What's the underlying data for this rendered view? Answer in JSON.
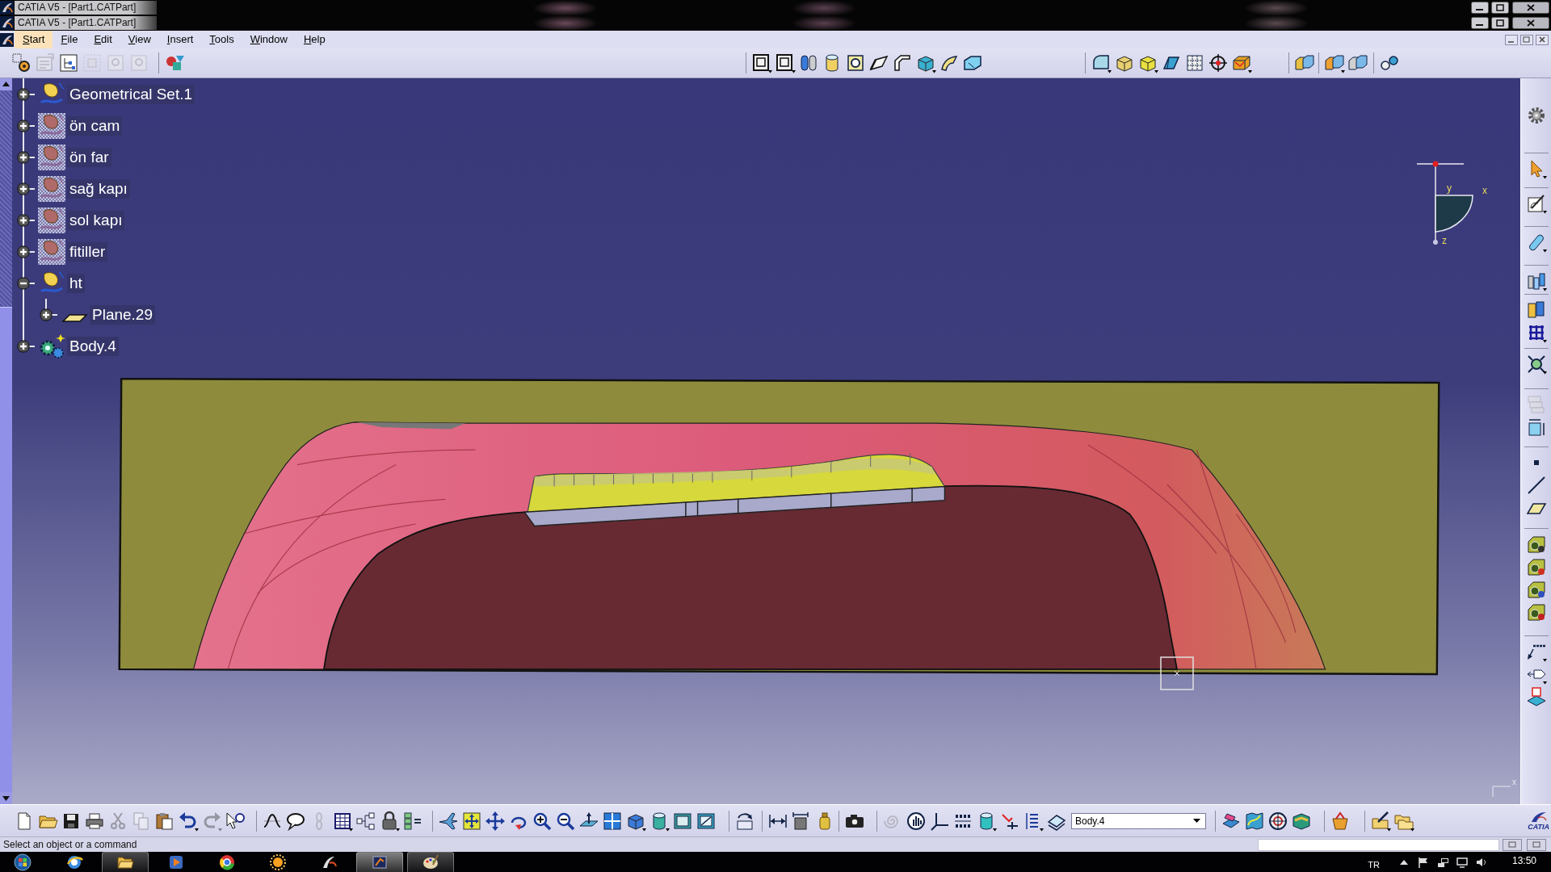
{
  "title_bars": [
    {
      "title": "CATIA V5 - [Part1.CATPart]"
    },
    {
      "title": "CATIA V5 - [Part1.CATPart]"
    }
  ],
  "menu": [
    {
      "label": "Start",
      "selected": true
    },
    {
      "label": "File",
      "selected": false
    },
    {
      "label": "Edit",
      "selected": false
    },
    {
      "label": "View",
      "selected": false
    },
    {
      "label": "Insert",
      "selected": false
    },
    {
      "label": "Tools",
      "selected": false
    },
    {
      "label": "Window",
      "selected": false
    },
    {
      "label": "Help",
      "selected": false
    }
  ],
  "toolbars": {
    "top": [
      {
        "disabled": false
      },
      {
        "disabled": true
      },
      {
        "disabled": false
      },
      {
        "disabled": true
      },
      {
        "disabled": true
      },
      {
        "disabled": true
      },
      {
        "disabled": false
      },
      {
        "disabled": false
      },
      {
        "disabled": false
      },
      {
        "disabled": false
      },
      {
        "disabled": false
      },
      {
        "disabled": false
      },
      {
        "disabled": false
      },
      {
        "disabled": false
      },
      {
        "disabled": false
      },
      {
        "disabled": false
      },
      {
        "disabled": false
      },
      {
        "disabled": false
      },
      {
        "disabled": false
      },
      {
        "disabled": false
      },
      {
        "disabled": false
      },
      {
        "disabled": false
      },
      {
        "disabled": false
      },
      {
        "disabled": false
      },
      {
        "disabled": false
      },
      {
        "disabled": false
      },
      {
        "disabled": false
      },
      {
        "disabled": false
      }
    ],
    "right": [
      {
        "disabled": false
      },
      {
        "disabled": false
      },
      {
        "disabled": false
      },
      {
        "disabled": false
      },
      {
        "disabled": false
      },
      {
        "disabled": false
      },
      {
        "disabled": false
      },
      {
        "disabled": false
      },
      {
        "disabled": true
      },
      {
        "disabled": false
      },
      {
        "disabled": false
      },
      {
        "disabled": false
      },
      {
        "disabled": false
      },
      {
        "disabled": false
      },
      {
        "disabled": false
      },
      {
        "disabled": false
      },
      {
        "disabled": false
      },
      {
        "disabled": false
      },
      {
        "disabled": false
      },
      {
        "disabled": false
      }
    ],
    "bottom_left": [
      {
        "disabled": false
      },
      {
        "disabled": false
      },
      {
        "disabled": false
      },
      {
        "disabled": false
      },
      {
        "disabled": true
      },
      {
        "disabled": true
      },
      {
        "disabled": false
      },
      {
        "disabled": false
      },
      {
        "disabled": true
      },
      {
        "disabled": false
      },
      {
        "disabled": false
      },
      {
        "disabled": false
      },
      {
        "disabled": true
      },
      {
        "disabled": false
      },
      {
        "disabled": false
      },
      {
        "disabled": false
      },
      {
        "disabled": false
      },
      {
        "disabled": false
      },
      {
        "disabled": false
      },
      {
        "disabled": false
      },
      {
        "disabled": false
      },
      {
        "disabled": false
      },
      {
        "disabled": false
      },
      {
        "disabled": false
      },
      {
        "disabled": false
      },
      {
        "disabled": false
      },
      {
        "disabled": false
      },
      {
        "disabled": false
      },
      {
        "disabled": false
      },
      {
        "disabled": false
      },
      {
        "disabled": false
      },
      {
        "disabled": false
      },
      {
        "disabled": false
      },
      {
        "disabled": false
      },
      {
        "disabled": true
      },
      {
        "disabled": false
      },
      {
        "disabled": false
      },
      {
        "disabled": false
      },
      {
        "disabled": false
      },
      {
        "disabled": false
      },
      {
        "disabled": false
      },
      {
        "disabled": false
      }
    ],
    "bottom_right": [
      {
        "disabled": false
      },
      {
        "disabled": false
      },
      {
        "disabled": false
      },
      {
        "disabled": false
      },
      {
        "disabled": false
      },
      {
        "disabled": false
      },
      {
        "disabled": false
      }
    ]
  },
  "tree": [
    {
      "label": "Geometrical Set.1",
      "kind": "geometrical_set",
      "hidden": false,
      "expanded": false
    },
    {
      "label": "ön cam",
      "kind": "geometrical_set",
      "hidden": true,
      "expanded": false
    },
    {
      "label": "ön far",
      "kind": "geometrical_set",
      "hidden": true,
      "expanded": false
    },
    {
      "label": "sağ kapı",
      "kind": "geometrical_set",
      "hidden": true,
      "expanded": false
    },
    {
      "label": "sol kapı",
      "kind": "geometrical_set",
      "hidden": true,
      "expanded": false
    },
    {
      "label": "fitiller",
      "kind": "geometrical_set",
      "hidden": true,
      "expanded": false
    },
    {
      "label": "ht",
      "kind": "geometrical_set",
      "hidden": false,
      "expanded": true,
      "children": [
        {
          "label": "Plane.29",
          "kind": "plane",
          "hidden": false,
          "expanded": false
        }
      ]
    },
    {
      "label": "Body.4",
      "kind": "body",
      "hidden": false,
      "expanded": false
    }
  ],
  "compass": {
    "labels": [
      "y",
      "x",
      "z"
    ]
  },
  "corner_axis": {
    "label": "x"
  },
  "body_selector": {
    "value": "Body.4"
  },
  "logo": {
    "text": "CATIA"
  },
  "status_bar": {
    "message": "Select an object or a command"
  },
  "taskbar": {
    "apps": [
      {
        "open": false,
        "selected": false
      },
      {
        "open": true,
        "selected": false
      },
      {
        "open": false,
        "selected": false
      },
      {
        "open": false,
        "selected": false
      },
      {
        "open": false,
        "selected": false
      },
      {
        "open": false,
        "selected": false
      },
      {
        "open": true,
        "selected": true
      },
      {
        "open": true,
        "selected": false
      }
    ],
    "language": "TR",
    "clock": "13:50"
  }
}
